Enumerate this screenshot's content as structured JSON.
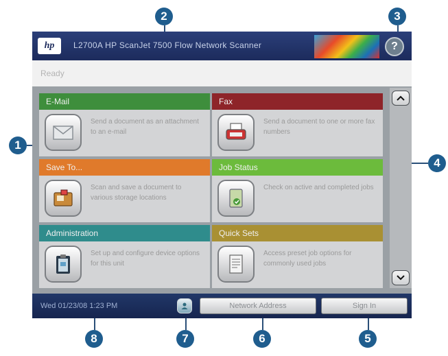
{
  "callouts": [
    "1",
    "2",
    "3",
    "4",
    "5",
    "6",
    "7",
    "8"
  ],
  "header": {
    "logo_text": "hp",
    "device_title": "L2700A HP ScanJet 7500 Flow Network Scanner",
    "help_label": "?"
  },
  "status": {
    "text": "Ready"
  },
  "tiles": [
    {
      "label": "E-Mail",
      "description": "Send a document as an attachment to an e-mail",
      "color": "#3e8e3c",
      "icon": "envelope-icon"
    },
    {
      "label": "Fax",
      "description": "Send a document to one or more fax numbers",
      "color": "#8e2429",
      "icon": "fax-machine-icon"
    },
    {
      "label": "Save To...",
      "description": "Scan and save a document to various storage locations",
      "color": "#e07a2b",
      "icon": "folder-icon"
    },
    {
      "label": "Job Status",
      "description": "Check on active and completed jobs",
      "color": "#6cbb3c",
      "icon": "job-status-icon"
    },
    {
      "label": "Administration",
      "description": "Set up and configure device options for this unit",
      "color": "#2f8c8c",
      "icon": "clipboard-icon"
    },
    {
      "label": "Quick Sets",
      "description": "Access preset job options for commonly used jobs",
      "color": "#a99033",
      "icon": "quick-sets-document-icon"
    }
  ],
  "footer": {
    "datetime": "Wed 01/23/08  1:23 PM",
    "network_address_label": "Network Address",
    "sign_in_label": "Sign In"
  },
  "colors": {
    "title_bar": "#1c2b5c",
    "callout": "#1f5d8e",
    "panel": "#9aa0a5"
  }
}
